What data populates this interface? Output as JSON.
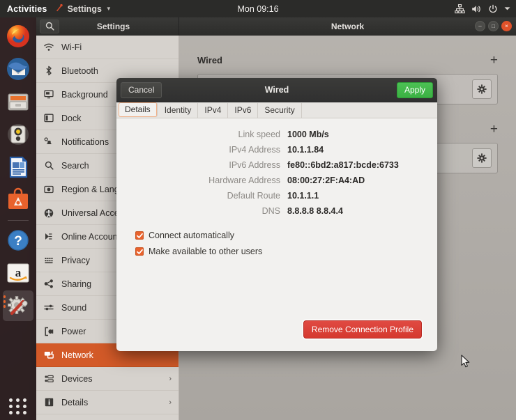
{
  "topbar": {
    "activities": "Activities",
    "app_menu": "Settings",
    "clock": "Mon 09:16",
    "icons": [
      "network-wired-icon",
      "volume-icon",
      "power-icon",
      "chevron-down-icon"
    ]
  },
  "dock": {
    "items": [
      {
        "name": "firefox",
        "label": "Firefox",
        "running": false
      },
      {
        "name": "thunderbird",
        "label": "Thunderbird",
        "running": false
      },
      {
        "name": "files",
        "label": "Files",
        "running": false
      },
      {
        "name": "rhythmbox",
        "label": "Rhythmbox",
        "running": false
      },
      {
        "name": "libreoffice-writer",
        "label": "LibreOffice Writer",
        "running": false
      },
      {
        "name": "ubuntu-software",
        "label": "Ubuntu Software",
        "running": false
      },
      {
        "name": "help",
        "label": "Help",
        "running": false
      },
      {
        "name": "amazon",
        "label": "Amazon",
        "running": false
      },
      {
        "name": "settings",
        "label": "Settings",
        "running": true
      }
    ],
    "show_apps_label": "Show Applications"
  },
  "window": {
    "sidebar_title": "Settings",
    "title": "Network",
    "search_icon": "search-icon",
    "controls": {
      "minimize": "–",
      "maximize": "□",
      "close": "×"
    }
  },
  "sidebar": {
    "items": [
      {
        "label": "Wi-Fi",
        "icon": "wifi-icon",
        "active": false,
        "chevron": ""
      },
      {
        "label": "Bluetooth",
        "icon": "bluetooth-icon",
        "active": false,
        "chevron": ""
      },
      {
        "label": "Background",
        "icon": "background-icon",
        "active": false,
        "chevron": ""
      },
      {
        "label": "Dock",
        "icon": "dock-icon",
        "active": false,
        "chevron": ""
      },
      {
        "label": "Notifications",
        "icon": "bell-icon",
        "active": false,
        "chevron": ""
      },
      {
        "label": "Search",
        "icon": "search-icon",
        "active": false,
        "chevron": ""
      },
      {
        "label": "Region & Language",
        "icon": "globe-icon",
        "active": false,
        "chevron": ""
      },
      {
        "label": "Universal Access",
        "icon": "accessibility-icon",
        "active": false,
        "chevron": ""
      },
      {
        "label": "Online Accounts",
        "icon": "online-accounts-icon",
        "active": false,
        "chevron": ""
      },
      {
        "label": "Privacy",
        "icon": "privacy-icon",
        "active": false,
        "chevron": ""
      },
      {
        "label": "Sharing",
        "icon": "share-icon",
        "active": false,
        "chevron": ""
      },
      {
        "label": "Sound",
        "icon": "sound-icon",
        "active": false,
        "chevron": ""
      },
      {
        "label": "Power",
        "icon": "power-plug-icon",
        "active": false,
        "chevron": ""
      },
      {
        "label": "Network",
        "icon": "network-icon",
        "active": true,
        "chevron": ""
      },
      {
        "label": "Devices",
        "icon": "devices-icon",
        "active": false,
        "chevron": "›"
      },
      {
        "label": "Details",
        "icon": "info-icon",
        "active": false,
        "chevron": "›"
      }
    ]
  },
  "panel": {
    "sections": [
      {
        "title": "Wired",
        "add_label": "+",
        "gear_label": "gear-icon"
      },
      {
        "title": "",
        "add_label": "+",
        "gear_label": "gear-icon"
      }
    ]
  },
  "dialog": {
    "cancel_label": "Cancel",
    "title": "Wired",
    "apply_label": "Apply",
    "tabs": [
      {
        "label": "Details",
        "active": true
      },
      {
        "label": "Identity",
        "active": false
      },
      {
        "label": "IPv4",
        "active": false
      },
      {
        "label": "IPv6",
        "active": false
      },
      {
        "label": "Security",
        "active": false
      }
    ],
    "fields": [
      {
        "label": "Link speed",
        "value": "1000 Mb/s"
      },
      {
        "label": "IPv4 Address",
        "value": "10.1.1.84"
      },
      {
        "label": "IPv6 Address",
        "value": "fe80::6bd2:a817:bcde:6733"
      },
      {
        "label": "Hardware Address",
        "value": "08:00:27:2F:A4:AD"
      },
      {
        "label": "Default Route",
        "value": "10.1.1.1"
      },
      {
        "label": "DNS",
        "value": "8.8.8.8 8.8.4.4"
      }
    ],
    "checkboxes": [
      {
        "label": "Connect automatically",
        "checked": true
      },
      {
        "label": "Make available to other users",
        "checked": true
      }
    ],
    "remove_label": "Remove Connection Profile"
  },
  "colors": {
    "accent_orange": "#d35a28",
    "apply_green": "#3bb143",
    "remove_red": "#d5392f",
    "checkbox_orange": "#e9622c",
    "topbar_bg": "#2b2b29"
  }
}
